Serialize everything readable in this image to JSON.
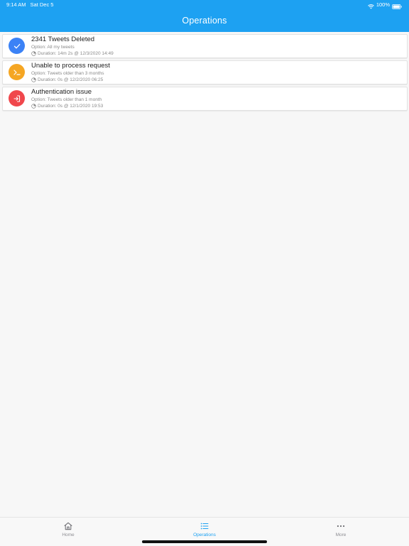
{
  "status_bar": {
    "time": "9:14 AM",
    "date": "Sat Dec 5",
    "battery": "100%"
  },
  "header": {
    "title": "Operations"
  },
  "colors": {
    "brand": "#1da1f2",
    "success": "#3b82f6",
    "warning": "#f5a623",
    "error": "#f0474c"
  },
  "operations": [
    {
      "status": "success",
      "icon": "check-icon",
      "title": "2341 Tweets Deleted",
      "option": "Option: All my tweets",
      "duration": "Duration: 14m 2s @ 12/3/2020 14:49"
    },
    {
      "status": "warning",
      "icon": "terminal-icon",
      "title": "Unable to process request",
      "option": "Option: Tweets older than 3 months",
      "duration": "Duration: 0s @ 12/2/2020 06:25"
    },
    {
      "status": "error",
      "icon": "sign-in-icon",
      "title": "Authentication issue",
      "option": "Option: Tweets older than 1 month",
      "duration": "Duration: 0s @ 12/1/2020 19:53"
    }
  ],
  "tabs": [
    {
      "label": "Home",
      "icon": "home-icon",
      "active": false
    },
    {
      "label": "Operations",
      "icon": "list-icon",
      "active": true
    },
    {
      "label": "More",
      "icon": "more-icon",
      "active": false
    }
  ]
}
